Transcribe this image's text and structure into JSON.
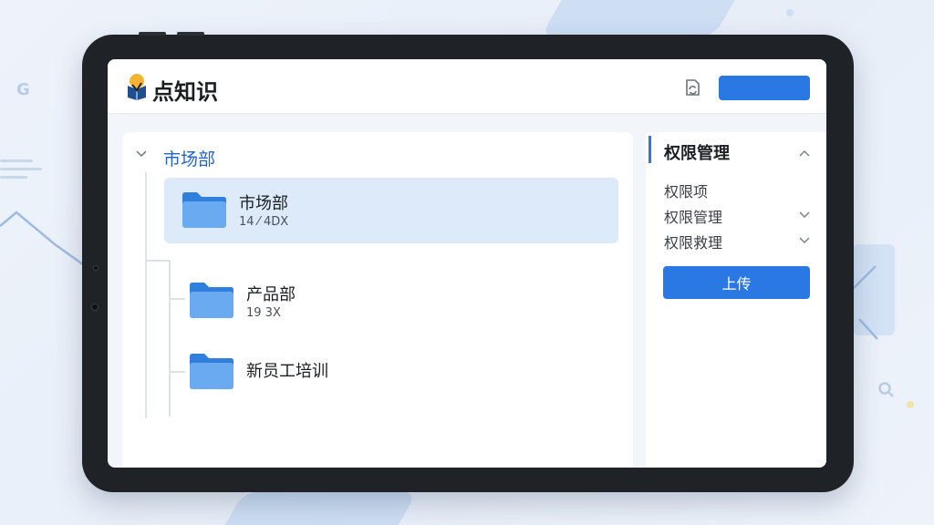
{
  "app": {
    "title": "点知识",
    "logo_icon": "book-logo-icon",
    "header_right_icon": "sync-file-icon"
  },
  "tree": {
    "root_label": "市场部",
    "items": [
      {
        "name": "市场部",
        "meta": "14 ⁄ 4DX",
        "selected": true
      },
      {
        "name": "产品部",
        "meta": "19 3X"
      },
      {
        "name": "新员工培训",
        "meta": ""
      }
    ]
  },
  "side_panel": {
    "title": "权限管理",
    "items": [
      {
        "label": "权限项",
        "has_chevron": false
      },
      {
        "label": "权限管理",
        "has_chevron": true
      },
      {
        "label": "权限救理",
        "has_chevron": true
      }
    ],
    "upload_label": "上传"
  },
  "colors": {
    "accent": "#2a78e4",
    "selected_bg": "#dceaf9",
    "folder": "#3d8ee8",
    "root_label": "#2364c9"
  }
}
